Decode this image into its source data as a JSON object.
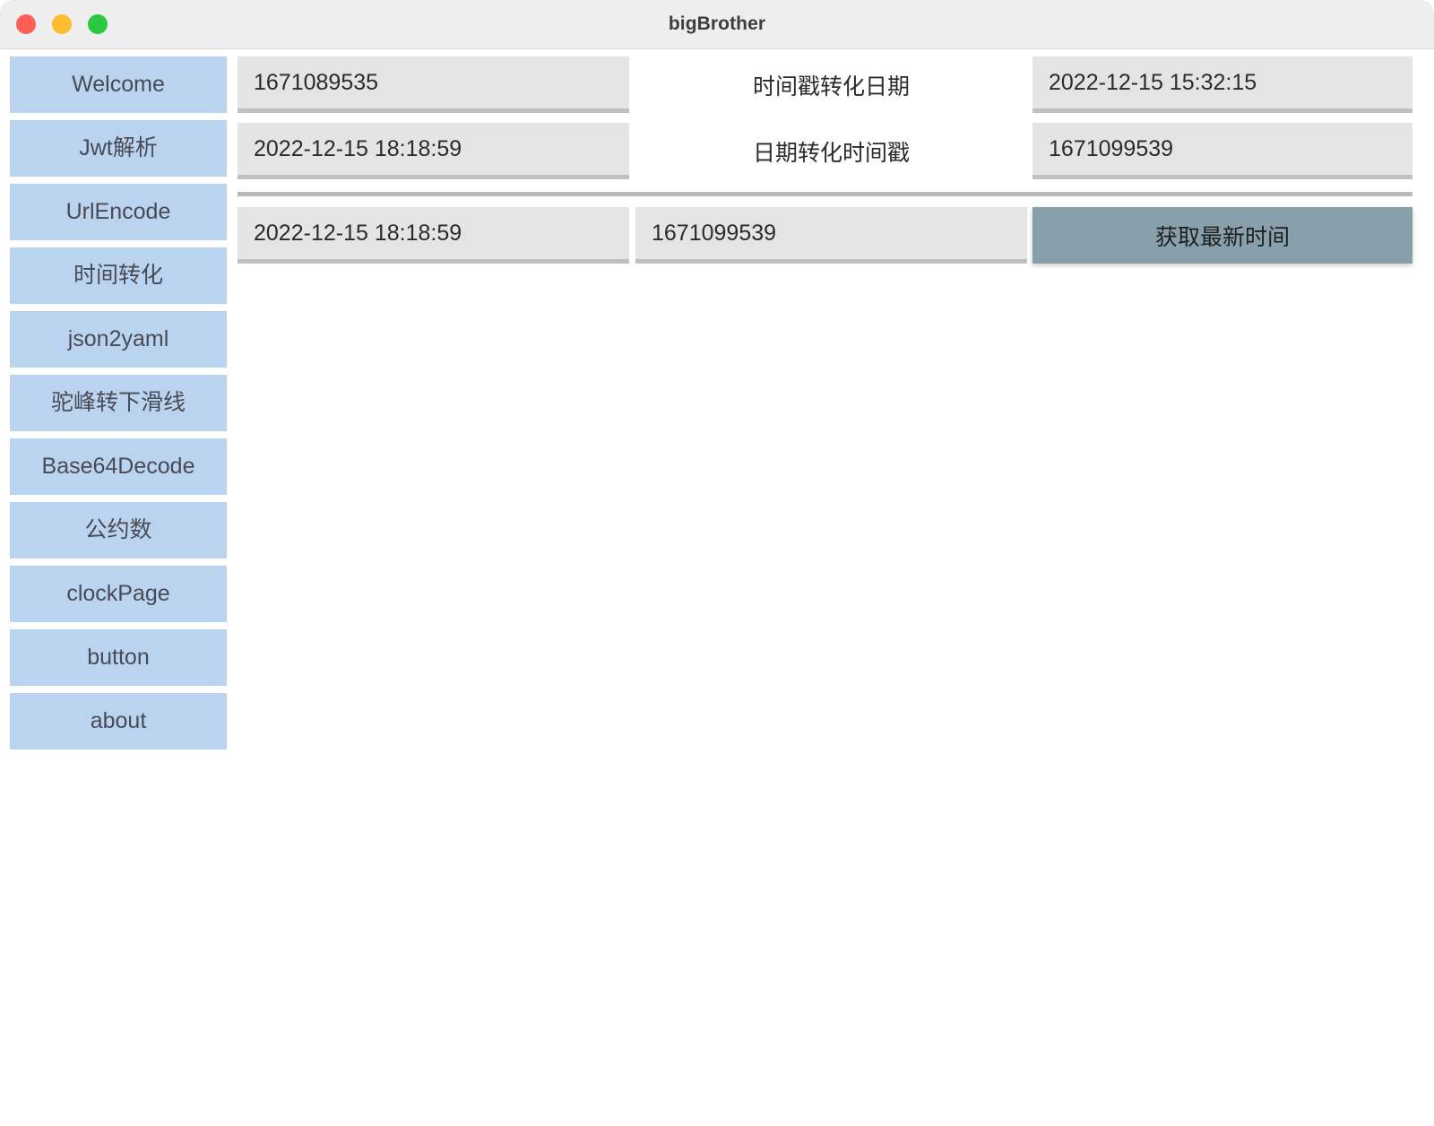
{
  "window": {
    "title": "bigBrother",
    "traffic_lights": [
      {
        "name": "close",
        "color": "#ff5f57"
      },
      {
        "name": "minimize",
        "color": "#febc2e"
      },
      {
        "name": "maximize",
        "color": "#28c840"
      }
    ]
  },
  "sidebar": {
    "items": [
      {
        "label": "Welcome"
      },
      {
        "label": "Jwt解析"
      },
      {
        "label": "UrlEncode"
      },
      {
        "label": "时间转化"
      },
      {
        "label": "json2yaml"
      },
      {
        "label": "驼峰转下滑线"
      },
      {
        "label": "Base64Decode"
      },
      {
        "label": "公约数"
      },
      {
        "label": "clockPage"
      },
      {
        "label": "button"
      },
      {
        "label": "about"
      }
    ]
  },
  "main": {
    "row1": {
      "input_value": "1671089535",
      "input_placeholder": "",
      "label": "时间戳转化日期",
      "output_value": "2022-12-15 15:32:15",
      "output_placeholder": ""
    },
    "row2": {
      "input_value": "2022-12-15 18:18:59",
      "input_placeholder": "",
      "label": "日期转化时间戳",
      "output_value": "1671099539",
      "output_placeholder": ""
    },
    "row3": {
      "current_datetime": "2022-12-15 18:18:59",
      "current_timestamp": "1671099539",
      "refresh_button_label": "获取最新时间"
    }
  },
  "colors": {
    "sidebar_item": "#bad4f0",
    "field_background": "#e4e4e4",
    "field_underline": "#c0c0c0",
    "button_accent": "#87a0ab",
    "titlebar": "#eeeeee",
    "divider": "#b8b8b8"
  }
}
